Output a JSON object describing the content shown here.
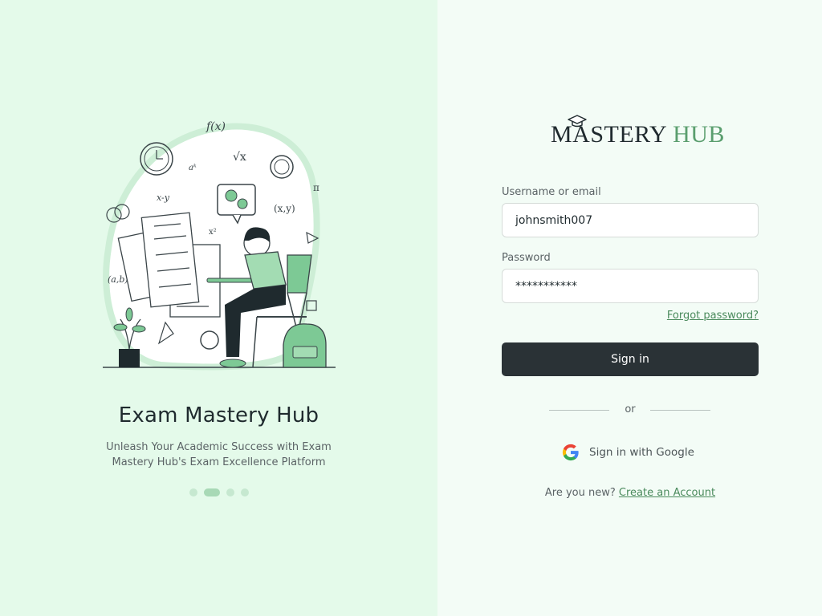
{
  "hero": {
    "title": "Exam Mastery Hub",
    "subtitle": "Unleash Your Academic Success with Exam Mastery Hub's Exam Excellence Platform"
  },
  "carousel": {
    "count": 4,
    "active_index": 1
  },
  "brand": {
    "word1": "MASTERY",
    "word2": "HUB"
  },
  "form": {
    "username_label": "Username or email",
    "username_value": "johnsmith007",
    "password_label": "Password",
    "password_value": "***********",
    "forgot_link": "Forgot password?",
    "signin_label": "Sign in",
    "divider_text": "or",
    "google_label": "Sign in with Google",
    "new_prompt": "Are you new?",
    "create_link": "Create an Account"
  },
  "colors": {
    "left_bg": "#e4faea",
    "right_bg": "#f3fcf6",
    "accent_green": "#5a9e6e",
    "button_dark": "#2a3236"
  }
}
